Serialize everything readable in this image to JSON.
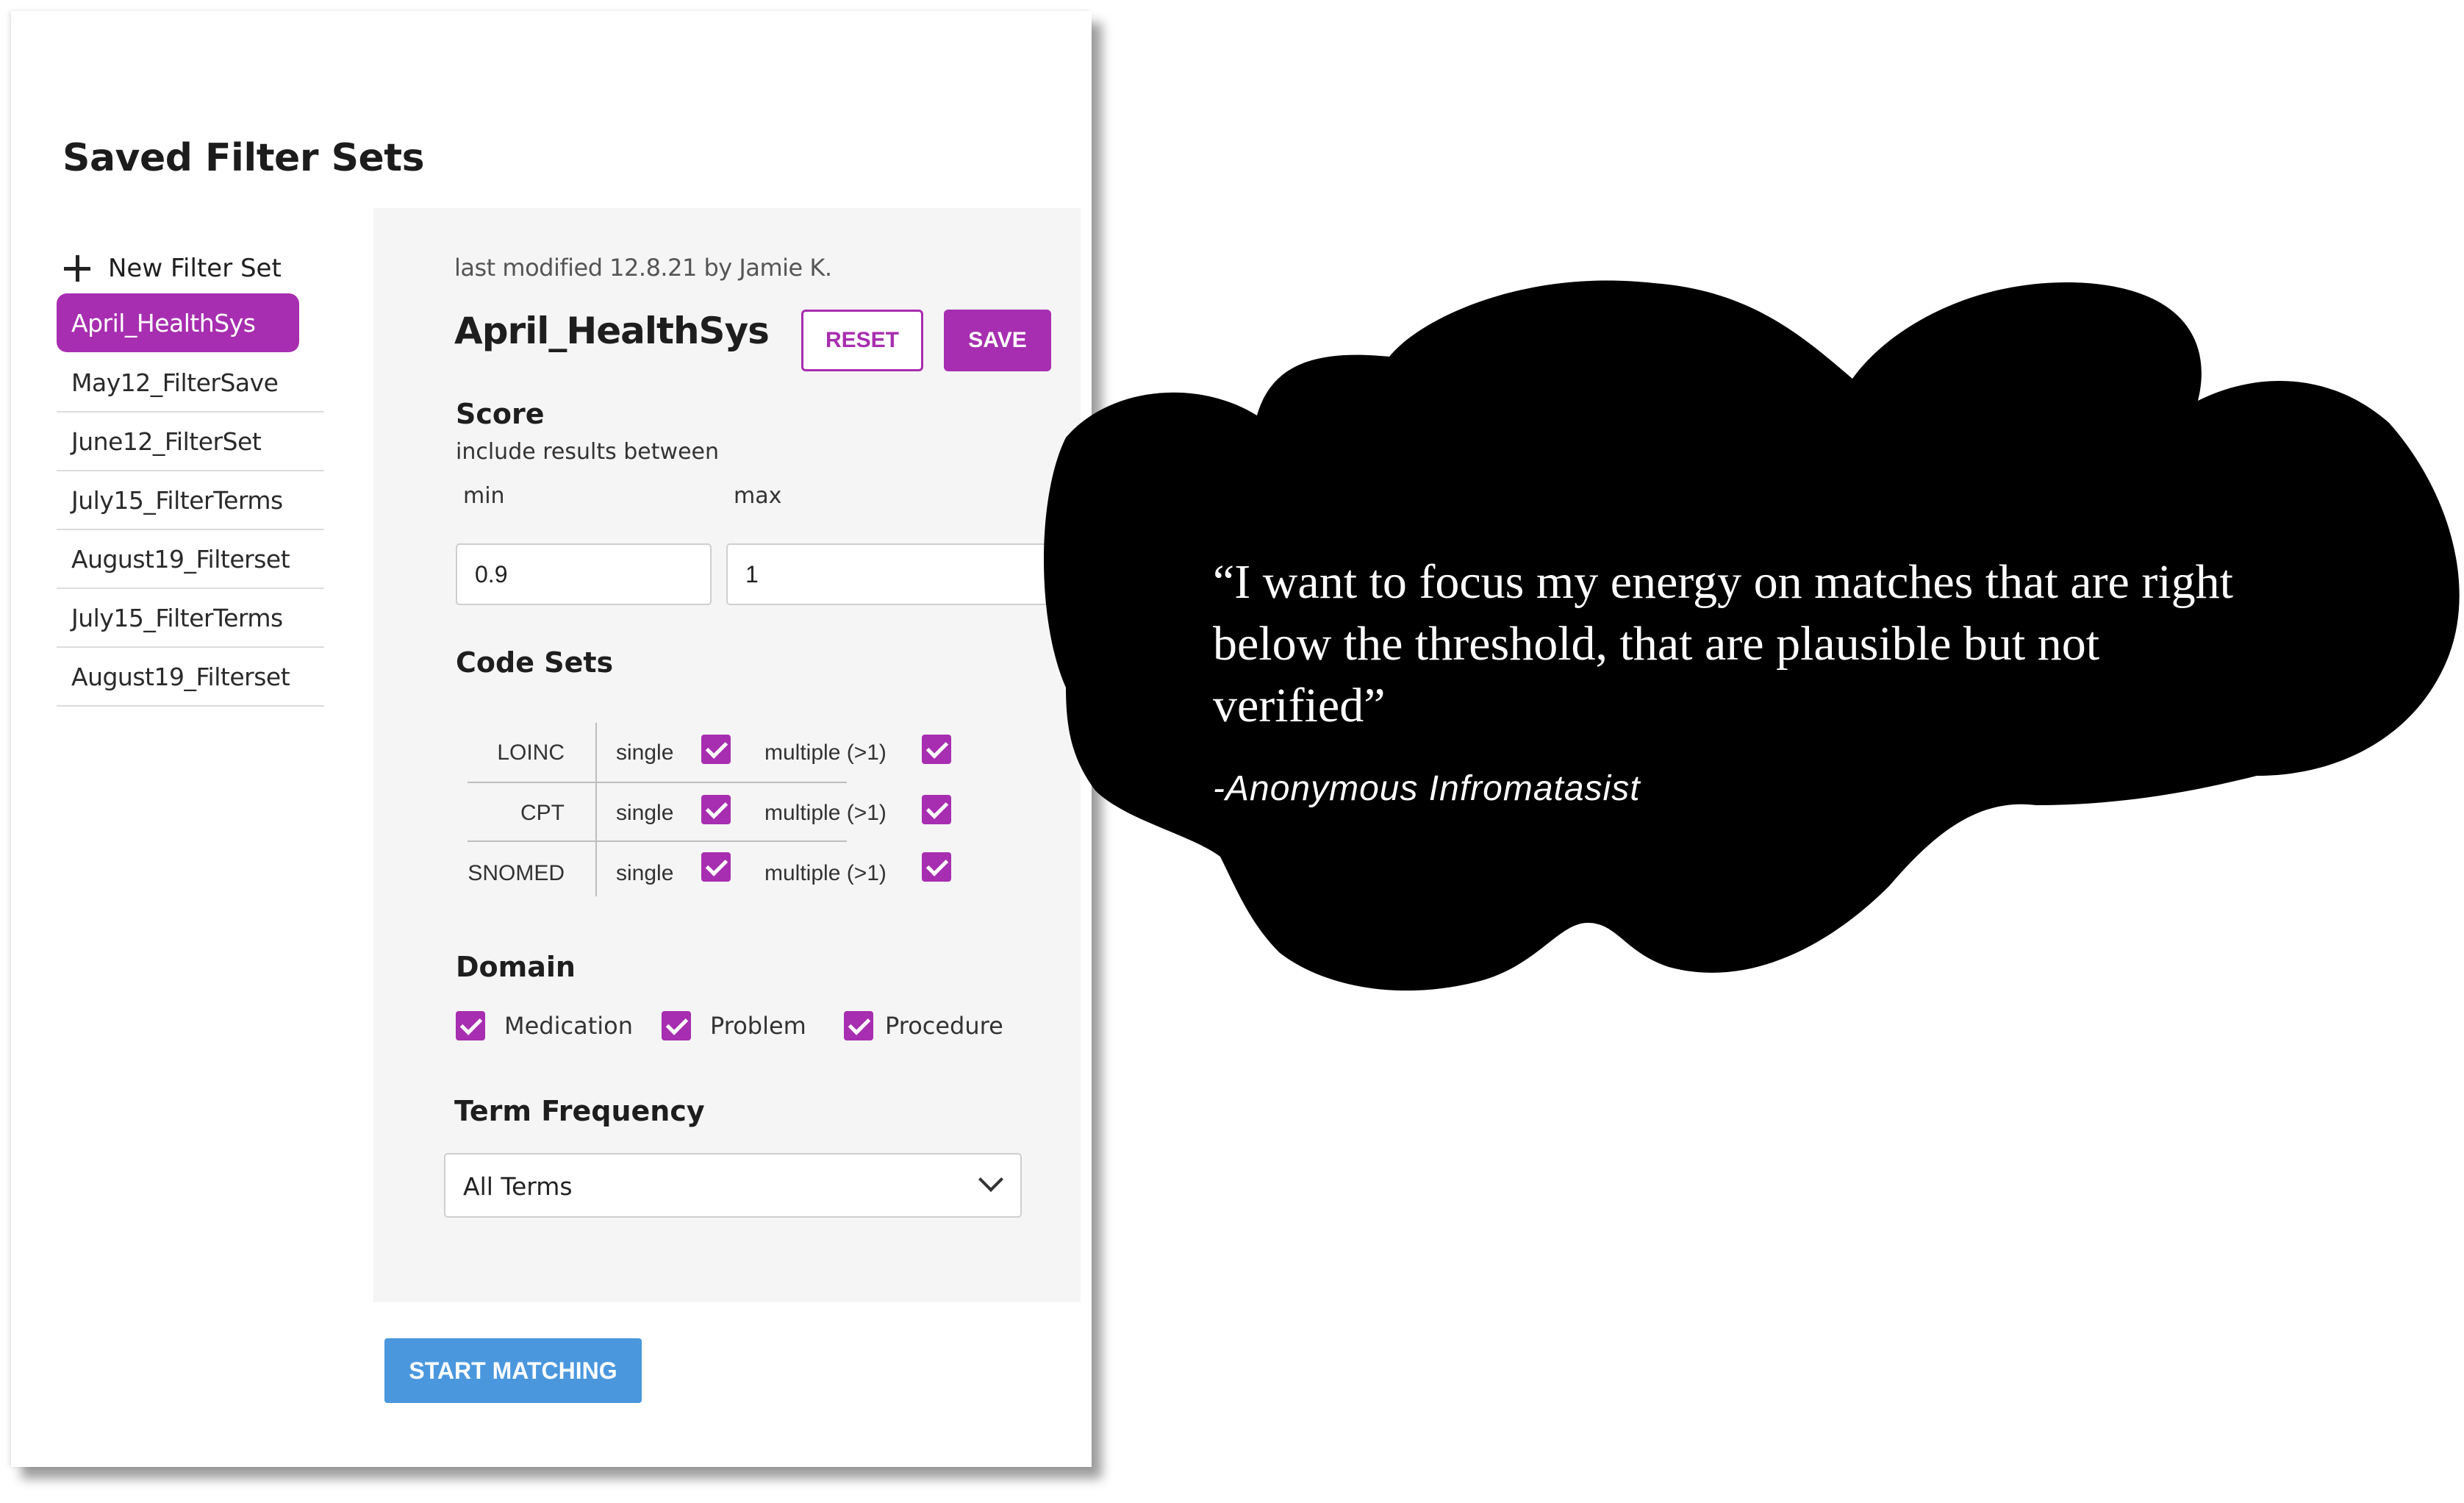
{
  "page_title": "Saved Filter Sets",
  "sidebar": {
    "new_label": "New Filter Set",
    "items": [
      {
        "label": "April_HealthSys",
        "active": true
      },
      {
        "label": "May12_FilterSave"
      },
      {
        "label": "June12_FilterSet"
      },
      {
        "label": "July15_FilterTerms"
      },
      {
        "label": "August19_Filterset"
      },
      {
        "label": "July15_FilterTerms"
      },
      {
        "label": "August19_Filterset"
      }
    ]
  },
  "editor": {
    "last_modified": "last modified 12.8.21 by Jamie K.",
    "name": "April_HealthSys",
    "reset_label": "RESET",
    "save_label": "SAVE",
    "score": {
      "title": "Score",
      "subtitle": "include results between",
      "min_label": "min",
      "min_value": "0.9",
      "max_label": "max",
      "max_value": "1"
    },
    "code_sets": {
      "title": "Code Sets",
      "single_label": "single",
      "multiple_label": "multiple (>1)",
      "rows": [
        {
          "name": "LOINC",
          "single": true,
          "multiple": true
        },
        {
          "name": "CPT",
          "single": true,
          "multiple": true
        },
        {
          "name": "SNOMED",
          "single": true,
          "multiple": true
        }
      ]
    },
    "domain": {
      "title": "Domain",
      "items": [
        {
          "label": "Medication",
          "checked": true
        },
        {
          "label": "Problem",
          "checked": true
        },
        {
          "label": "Procedure",
          "checked": true
        }
      ]
    },
    "term_frequency": {
      "title": "Term Frequency",
      "selected": "All Terms"
    }
  },
  "start_label": "START MATCHING",
  "quote": {
    "text": "“I want to focus my energy on matches that are right below the threshold, that are plausible but not verified”",
    "author": "-Anonymous Infromatasist"
  },
  "colors": {
    "accent": "#a72eb0",
    "primary_button": "#4a97de",
    "panel_bg": "#f5f5f5",
    "cloud": "#000000"
  }
}
